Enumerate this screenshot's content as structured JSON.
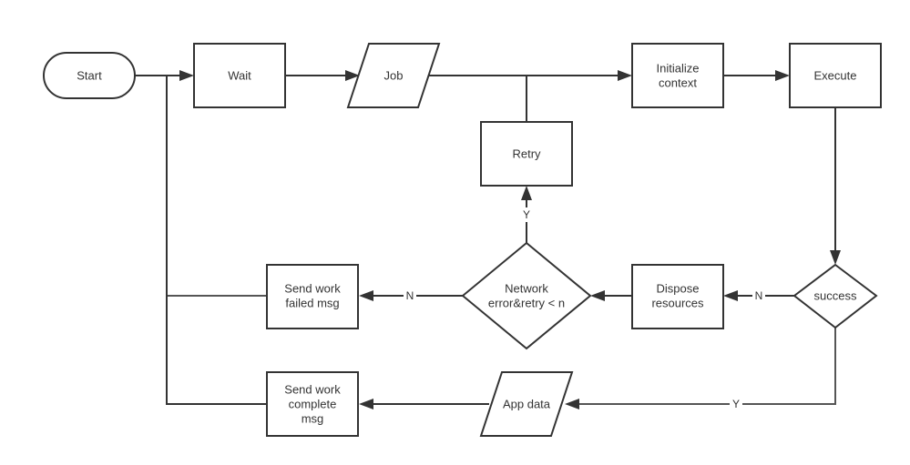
{
  "diagram": {
    "type": "flowchart",
    "nodes": {
      "start": {
        "shape": "terminator",
        "lines": [
          "Start"
        ]
      },
      "wait": {
        "shape": "process",
        "lines": [
          "Wait"
        ]
      },
      "job": {
        "shape": "data",
        "lines": [
          "Job"
        ]
      },
      "init": {
        "shape": "process",
        "lines": [
          "Initialize",
          "context"
        ]
      },
      "execute": {
        "shape": "process",
        "lines": [
          "Execute"
        ]
      },
      "retry": {
        "shape": "process",
        "lines": [
          "Retry"
        ]
      },
      "network": {
        "shape": "decision",
        "lines": [
          "Network",
          "error&retry < n"
        ]
      },
      "dispose": {
        "shape": "process",
        "lines": [
          "Dispose",
          "resources"
        ]
      },
      "success": {
        "shape": "decision",
        "lines": [
          "success"
        ]
      },
      "failed": {
        "shape": "process",
        "lines": [
          "Send work",
          "failed msg"
        ]
      },
      "appdata": {
        "shape": "data",
        "lines": [
          "App data"
        ]
      },
      "complete": {
        "shape": "process",
        "lines": [
          "Send work",
          "complete",
          "msg"
        ]
      }
    },
    "edges": [
      {
        "from": "start",
        "to": "wait",
        "label": ""
      },
      {
        "from": "wait",
        "to": "job",
        "label": ""
      },
      {
        "from": "job",
        "to": "init",
        "label": ""
      },
      {
        "from": "retry",
        "to": "init",
        "label": ""
      },
      {
        "from": "init",
        "to": "execute",
        "label": ""
      },
      {
        "from": "execute",
        "to": "success",
        "label": ""
      },
      {
        "from": "success",
        "to": "dispose",
        "label": "N"
      },
      {
        "from": "success",
        "to": "appdata",
        "label": "Y"
      },
      {
        "from": "dispose",
        "to": "network",
        "label": ""
      },
      {
        "from": "network",
        "to": "retry",
        "label": "Y"
      },
      {
        "from": "network",
        "to": "failed",
        "label": "N"
      },
      {
        "from": "appdata",
        "to": "complete",
        "label": ""
      },
      {
        "from": "failed",
        "to": "wait",
        "label": ""
      },
      {
        "from": "complete",
        "to": "wait",
        "label": ""
      }
    ],
    "edge_labels": {
      "success_no": "N",
      "success_yes": "Y",
      "network_yes": "Y",
      "network_no": "N"
    }
  }
}
